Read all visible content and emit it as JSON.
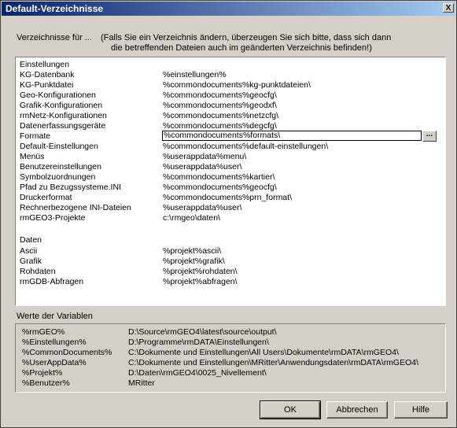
{
  "window": {
    "title": "Default-Verzeichnisse",
    "close_label": "X"
  },
  "header": {
    "label": "Verzeichnisse für ...",
    "note_line1": "(Falls Sie ein Verzeichnis ändern, überzeugen Sie sich bitte, dass sich dann",
    "note_line2": "die betreffenden Dateien auch im geänderten Verzeichnis befinden!)"
  },
  "list": {
    "rows": [
      {
        "name": "Einstellungen",
        "value": ""
      },
      {
        "name": "KG-Datenbank",
        "value": "%einstellungen%"
      },
      {
        "name": "KG-Punktdatei",
        "value": "%commondocuments%kg-punktdateien\\"
      },
      {
        "name": "Geo-Konfigurationen",
        "value": "%commondocuments%geocfg\\"
      },
      {
        "name": "Grafik-Konfigurationen",
        "value": "%commondocuments%geodxf\\"
      },
      {
        "name": "rmNetz-Konfigurationen",
        "value": "%commondocuments%netzcfg\\"
      },
      {
        "name": "Datenerfassungsgeräte",
        "value": "%commondocuments%degcfg\\"
      },
      {
        "name": "Formate",
        "value": "%commondocuments%formats\\"
      },
      {
        "name": "Default-Einstellungen",
        "value": "%commondocuments%default-einstellungen\\"
      },
      {
        "name": "Menüs",
        "value": "%userappdata%menu\\"
      },
      {
        "name": "Benutzereinstellungen",
        "value": "%userappdata%user\\"
      },
      {
        "name": "Symbolzuordnungen",
        "value": "%commondocuments%kartier\\"
      },
      {
        "name": "Pfad zu Bezugssysteme.INI",
        "value": "%commondocuments%geocfg\\"
      },
      {
        "name": "Druckerformat",
        "value": "%commondocuments%prn_format\\"
      },
      {
        "name": "Rechnerbezogene INI-Dateien",
        "value": "%userappdata%user\\"
      },
      {
        "name": "rmGEO3-Projekte",
        "value": "c:\\rmgeo\\daten\\"
      },
      {
        "name": "",
        "value": ""
      },
      {
        "name": "Daten",
        "value": ""
      },
      {
        "name": "Ascii",
        "value": "%projekt%ascii\\"
      },
      {
        "name": "Grafik",
        "value": "%projekt%grafik\\"
      },
      {
        "name": "Rohdaten",
        "value": "%projekt%rohdaten\\"
      },
      {
        "name": "rmGDB-Abfragen",
        "value": "%projekt%abfragen\\"
      }
    ],
    "browse_label": "..."
  },
  "variables": {
    "label": "Werte der Variablen",
    "rows": [
      {
        "name": "%rmGEO%",
        "value": "D:\\Source\\rmGEO4\\latest\\source\\output\\"
      },
      {
        "name": "%Einstellungen%",
        "value": "D:\\Programme\\rmDATA\\Einstellungen\\"
      },
      {
        "name": "%CommonDocuments%",
        "value": "C:\\Dokumente und Einstellungen\\All Users\\Dokumente\\rmDATA\\rmGEO4\\"
      },
      {
        "name": "%UserAppData%",
        "value": "C:\\Dokumente und Einstellungen\\MRitter\\Anwendungsdaten\\rmDATA\\rmGEO4\\"
      },
      {
        "name": "%Projekt%",
        "value": "D:\\Daten\\rmGEO4\\0025_Nivellement\\"
      },
      {
        "name": "%Benutzer%",
        "value": "MRitter"
      }
    ]
  },
  "buttons": {
    "ok": "OK",
    "cancel": "Abbrechen",
    "help": "Hilfe"
  }
}
